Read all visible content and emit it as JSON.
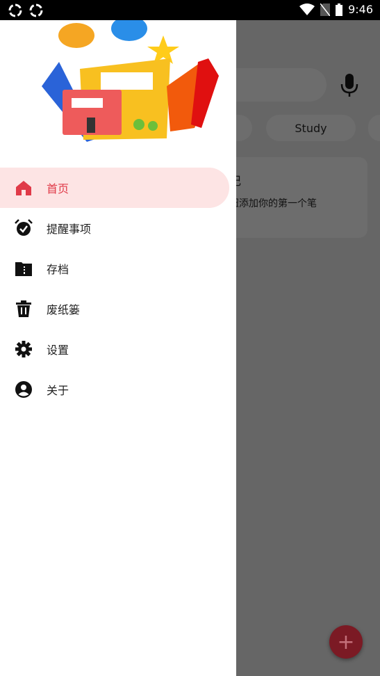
{
  "status_bar": {
    "time": "9:46",
    "icons": [
      "sync-icon",
      "sync-icon",
      "wifi-icon",
      "no-sim-icon",
      "battery-icon"
    ]
  },
  "background": {
    "chip_label": "Study",
    "empty_title_fragment": "记",
    "empty_desc_fragment": "钮添加你的第一个笔",
    "fab_label": "+"
  },
  "drawer": {
    "accent": "#e03a48",
    "items": [
      {
        "label": "首页",
        "icon": "home-icon",
        "active": true
      },
      {
        "label": "提醒事项",
        "icon": "alarm-check-icon"
      },
      {
        "label": "存档",
        "icon": "archive-folder-icon"
      },
      {
        "label": "废纸篓",
        "icon": "trash-icon"
      },
      {
        "label": "设置",
        "icon": "gear-icon"
      },
      {
        "label": "关于",
        "icon": "account-circle-icon"
      }
    ]
  }
}
